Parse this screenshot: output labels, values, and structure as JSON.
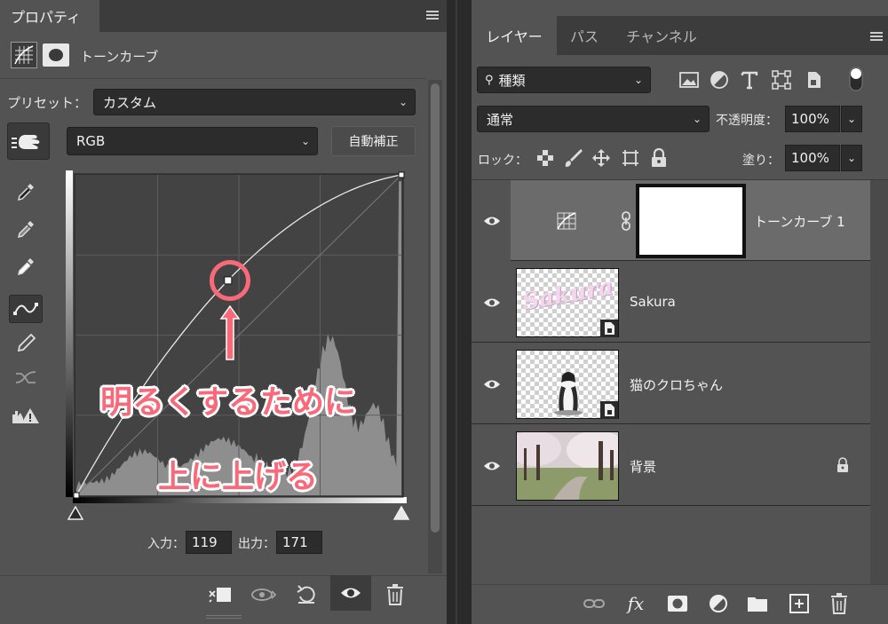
{
  "properties": {
    "tab_title": "プロパティ",
    "adjustment_name": "トーンカーブ",
    "preset_label": "プリセット：",
    "preset_value": "カスタム",
    "channel_value": "RGB",
    "auto_button": "自動補正",
    "input_label": "入力：",
    "input_value": "119",
    "output_label": "出力：",
    "output_value": "171"
  },
  "annotation": {
    "line1": "明るくするために",
    "line2": "上に上げる",
    "color": "#f86a79"
  },
  "curve_point": {
    "input": 119,
    "output": 171
  },
  "layers_panel": {
    "tabs": [
      {
        "label": "レイヤー",
        "active": true
      },
      {
        "label": "パス",
        "active": false
      },
      {
        "label": "チャンネル",
        "active": false
      }
    ],
    "filter_label": "種類",
    "blend_mode": "通常",
    "opacity_label": "不透明度：",
    "opacity_value": "100%",
    "lock_label": "ロック：",
    "fill_label": "塗り：",
    "fill_value": "100%",
    "layers": [
      {
        "name": "トーンカーブ 1",
        "type": "adjustment",
        "selected": true
      },
      {
        "name": "Sakura",
        "type": "smart-object",
        "selected": false
      },
      {
        "name": "猫のクロちゃん",
        "type": "smart-object",
        "selected": false
      },
      {
        "name": "背景",
        "type": "background",
        "locked": true,
        "selected": false
      }
    ],
    "thumb_text": "Sakura"
  }
}
